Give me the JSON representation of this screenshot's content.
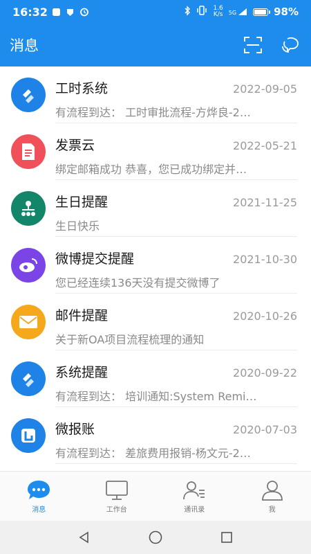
{
  "status_bar": {
    "time": "16:32",
    "net_speed_value": "1.6",
    "net_speed_unit": "K/s",
    "signal_label": "5G",
    "battery_percent": 0.98,
    "battery_text": "98%"
  },
  "header": {
    "title": "消息",
    "actions": [
      "scan-icon",
      "chat-bubble-icon"
    ]
  },
  "messages": [
    {
      "title": "工时系统",
      "date": "2022-09-05",
      "preview": "有流程到达：  工时审批流程-方烨良-2…",
      "icon": "workflow-icon",
      "color": "#1e82e6"
    },
    {
      "title": "发票云",
      "date": "2022-05-21",
      "preview": "绑定邮箱成功 恭喜，您已成功绑定并…",
      "icon": "invoice-icon",
      "color": "#f0505a"
    },
    {
      "title": "生日提醒",
      "date": "2021-11-25",
      "preview": "生日快乐",
      "icon": "birthday-icon",
      "color": "#13866a"
    },
    {
      "title": "微博提交提醒",
      "date": "2021-10-30",
      "preview": "您已经连续136天没有提交微博了",
      "icon": "weibo-icon",
      "color": "#7a44e6"
    },
    {
      "title": "邮件提醒",
      "date": "2020-10-26",
      "preview": "关于新OA项目流程梳理的通知",
      "icon": "mail-icon",
      "color": "#f6a81c"
    },
    {
      "title": "系统提醒",
      "date": "2020-09-22",
      "preview": "有流程到达：  培训通知:System Remi…",
      "icon": "workflow-icon",
      "color": "#1e82e6"
    },
    {
      "title": "微报账",
      "date": "2020-07-03",
      "preview": "差旅费用报销-杨文元-2…",
      "preview_prefix": "有流程到达：  ",
      "icon": "expense-icon",
      "color": "#1e82e6"
    }
  ],
  "tabs": [
    {
      "label": "消息",
      "icon": "message-icon",
      "active": true
    },
    {
      "label": "工作台",
      "icon": "workbench-icon",
      "active": false
    },
    {
      "label": "通讯录",
      "icon": "contacts-icon",
      "active": false
    },
    {
      "label": "我",
      "icon": "profile-icon",
      "active": false
    }
  ],
  "colors": {
    "primary": "#1e8cec",
    "tab_inactive": "#777777"
  }
}
